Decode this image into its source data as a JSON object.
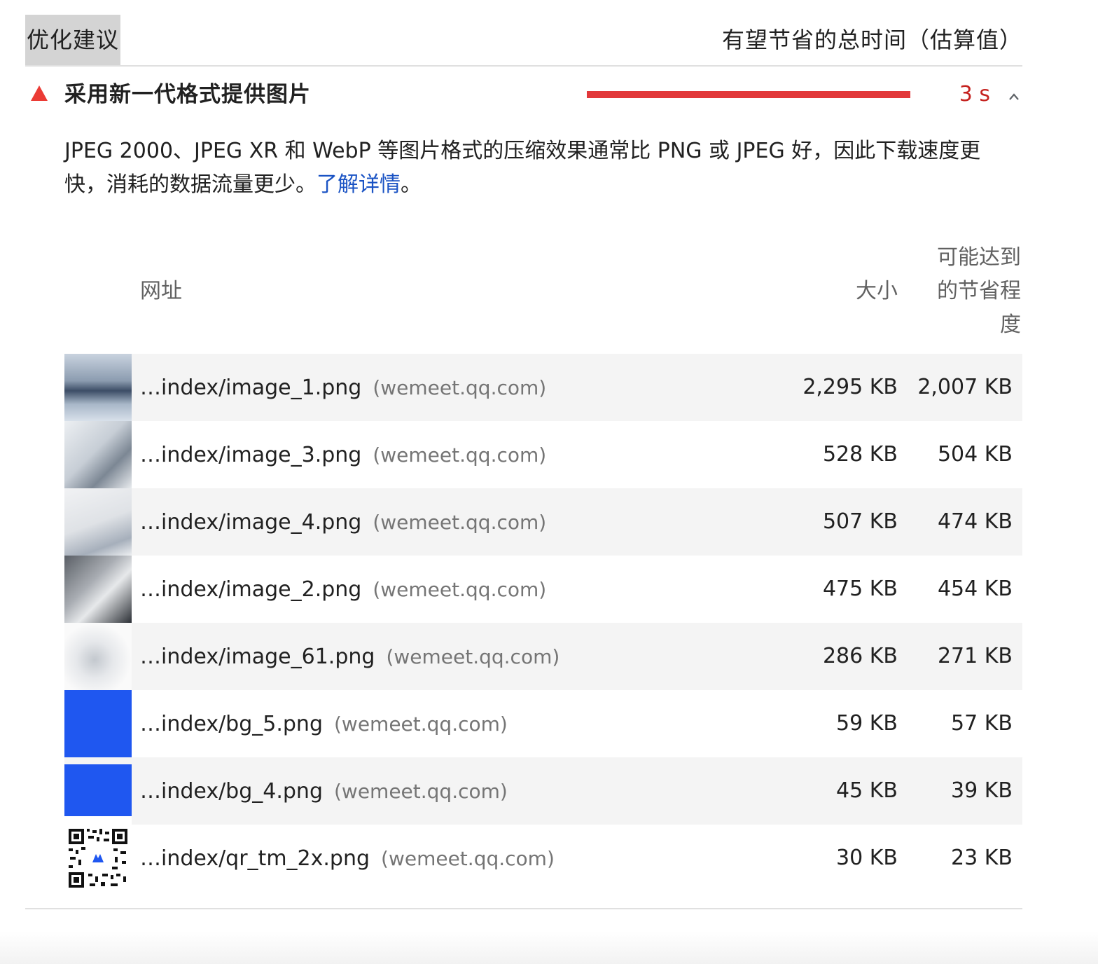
{
  "header": {
    "left_title": "优化建议",
    "right_title": "有望节省的总时间（估算值）"
  },
  "audit": {
    "title": "采用新一代格式提供图片",
    "savings_label": "3 s",
    "savings_fraction": 1.0,
    "status": "fail",
    "icon": "warning-triangle-icon",
    "expanded_icon": "chevron-up-icon",
    "description_text": "JPEG 2000、JPEG XR 和 WebP 等图片格式的压缩效果通常比 PNG 或 JPEG 好，因此下载速度更快，消耗的数据流量更少。",
    "learn_more": "了解详情",
    "description_end": "。",
    "colors": {
      "fail": "#e2383a",
      "link": "#1a53c4",
      "value": "#c5221f"
    }
  },
  "table": {
    "columns": {
      "url": "网址",
      "size": "大小",
      "savings": "可能达到的节省程度"
    },
    "rows": [
      {
        "path": "…index/image_1.png",
        "host": "(wemeet.qq.com)",
        "size": "2,295 KB",
        "savings": "2,007 KB",
        "thumb": "city-skyline-photo"
      },
      {
        "path": "…index/image_3.png",
        "host": "(wemeet.qq.com)",
        "size": "528 KB",
        "savings": "504 KB",
        "thumb": "hands-phone-photo"
      },
      {
        "path": "…index/image_4.png",
        "host": "(wemeet.qq.com)",
        "size": "507 KB",
        "savings": "474 KB",
        "thumb": "office-desk-photo"
      },
      {
        "path": "…index/image_2.png",
        "host": "(wemeet.qq.com)",
        "size": "475 KB",
        "savings": "454 KB",
        "thumb": "laptop-typing-photo"
      },
      {
        "path": "…index/image_61.png",
        "host": "(wemeet.qq.com)",
        "size": "286 KB",
        "savings": "271 KB",
        "thumb": "globe-graphic"
      },
      {
        "path": "…index/bg_5.png",
        "host": "(wemeet.qq.com)",
        "size": "59 KB",
        "savings": "57 KB",
        "thumb": "blue-background"
      },
      {
        "path": "…index/bg_4.png",
        "host": "(wemeet.qq.com)",
        "size": "45 KB",
        "savings": "39 KB",
        "thumb": "blue-background"
      },
      {
        "path": "…index/qr_tm_2x.png",
        "host": "(wemeet.qq.com)",
        "size": "30 KB",
        "savings": "23 KB",
        "thumb": "qr-code"
      }
    ]
  }
}
